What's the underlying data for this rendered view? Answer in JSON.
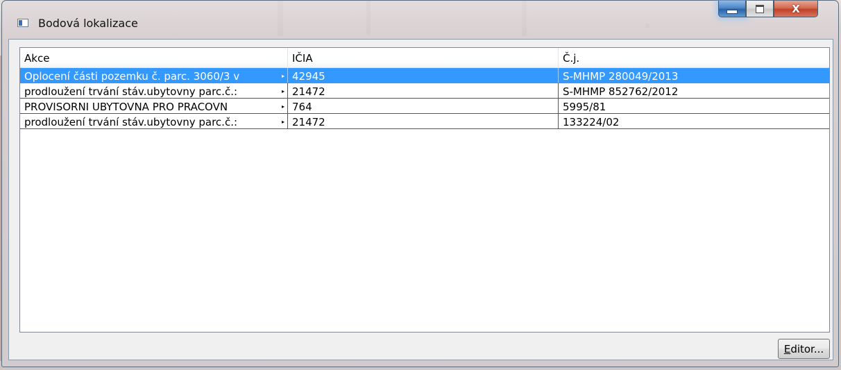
{
  "window": {
    "title": "Bodová lokalizace",
    "controls": {
      "minimize": "minimize-icon",
      "maximize": "maximize-icon",
      "close_glyph": "X"
    }
  },
  "table": {
    "columns": [
      "Akce",
      "IČIA",
      "Č.j."
    ],
    "rows": [
      {
        "akce": "Oplocení části pozemku č. parc. 3060/3 v",
        "icia": "42945",
        "cj": "S-MHMP 280049/2013",
        "selected": true
      },
      {
        "akce": "prodloužení trvání stáv.ubytovny parc.č.:",
        "icia": "21472",
        "cj": "S-MHMP 852762/2012",
        "selected": false
      },
      {
        "akce": "PROVISORNI UBYTOVNA PRO PRACOVN",
        "icia": "764",
        "cj": "5995/81",
        "selected": false
      },
      {
        "akce": "prodloužení trvání stáv.ubytovny parc.č.:",
        "icia": "21472",
        "cj": "133224/02",
        "selected": false
      }
    ],
    "truncation_marker": "▸"
  },
  "buttons": {
    "editor_first": "E",
    "editor_rest": "ditor..."
  },
  "colors": {
    "selection": "#3399ff",
    "window_border": "#5a6b7d"
  }
}
